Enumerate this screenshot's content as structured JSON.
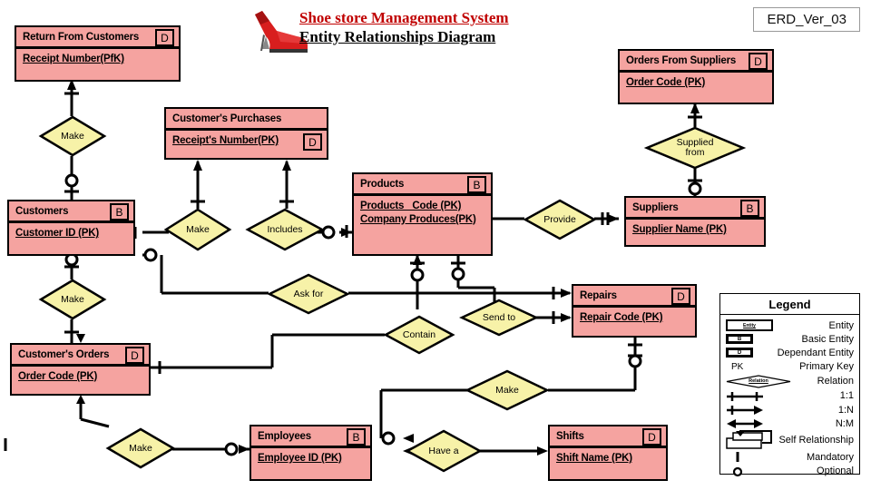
{
  "header": {
    "title_line1": "Shoe store Management System ",
    "title_line2": "Entity   Relationships   Diagram",
    "version": "ERD_Ver_03",
    "logo_icon": "red-high-heel-shoe-icon"
  },
  "colors": {
    "entity_fill": "#F5A3A0",
    "relation_fill": "#F7F2A8",
    "line": "#000000",
    "title_red": "#C00000",
    "version_border": "#999999"
  },
  "entities": [
    {
      "id": "return-from-customers",
      "name": "Return From Customers",
      "badge": "D",
      "badge_row": "head",
      "attributes": [
        "Receipt Number(PfK)"
      ]
    },
    {
      "id": "customers-purchases",
      "name": "Customer's Purchases",
      "badge": "D",
      "badge_row": "row2",
      "attributes": [
        "Receipt's Number(PK)"
      ]
    },
    {
      "id": "orders-from-suppliers",
      "name": "Orders From Suppliers",
      "badge": "D",
      "badge_row": "head",
      "attributes": [
        "Order Code (PK)"
      ]
    },
    {
      "id": "customers",
      "name": "Customers",
      "badge": "B",
      "badge_row": "head",
      "attributes": [
        "Customer ID  (PK)"
      ]
    },
    {
      "id": "products",
      "name": "Products",
      "badge": "B",
      "badge_row": "head",
      "attributes": [
        "Products_ Code (PK)",
        "Company Produces(PK)"
      ]
    },
    {
      "id": "suppliers",
      "name": "Suppliers",
      "badge": "B",
      "badge_row": "head",
      "attributes": [
        "Supplier Name (PK)"
      ]
    },
    {
      "id": "customers-orders",
      "name": "Customer's Orders",
      "badge": "D",
      "badge_row": "head",
      "attributes": [
        "Order Code (PK)"
      ]
    },
    {
      "id": "repairs",
      "name": "Repairs",
      "badge": "D",
      "badge_row": "head",
      "attributes": [
        "Repair Code (PK)"
      ]
    },
    {
      "id": "employees",
      "name": "Employees",
      "badge": "B",
      "badge_row": "head",
      "attributes": [
        "Employee ID  (PK)"
      ]
    },
    {
      "id": "shifts",
      "name": "Shifts",
      "badge": "D",
      "badge_row": "head",
      "attributes": [
        "Shift Name (PK)"
      ]
    }
  ],
  "relationships": [
    {
      "id": "make-return",
      "label": "Make"
    },
    {
      "id": "make-purchases",
      "label": "Make"
    },
    {
      "id": "includes",
      "label": "Includes"
    },
    {
      "id": "supplied-from",
      "label": "Supplied\nfrom"
    },
    {
      "id": "provide",
      "label": "Provide"
    },
    {
      "id": "make-orders",
      "label": "Make"
    },
    {
      "id": "ask-for",
      "label": "Ask for"
    },
    {
      "id": "contain",
      "label": "Contain"
    },
    {
      "id": "send-to",
      "label": "Send to"
    },
    {
      "id": "make-repairs",
      "label": "Make"
    },
    {
      "id": "make-employees",
      "label": "Make"
    },
    {
      "id": "have-a",
      "label": "Have a"
    }
  ],
  "legend": {
    "title": "Legend",
    "rows": [
      {
        "icon": "entity-box-icon",
        "icon_text": "Entity",
        "label": "Entity"
      },
      {
        "icon": "basic-entity-box-icon",
        "icon_text": "B",
        "label": "Basic Entity"
      },
      {
        "icon": "dependant-entity-box-icon",
        "icon_text": "D",
        "label": "Dependant  Entity"
      },
      {
        "icon": "primary-key-icon",
        "icon_text": "PK",
        "label": "Primary Key"
      },
      {
        "icon": "relation-diamond-icon",
        "icon_text": "Relation",
        "label": "Relation"
      },
      {
        "icon": "one-to-one-icon",
        "icon_text": "",
        "label": "1:1"
      },
      {
        "icon": "one-to-many-icon",
        "icon_text": "",
        "label": "1:N"
      },
      {
        "icon": "many-to-many-icon",
        "icon_text": "",
        "label": "N:M"
      },
      {
        "icon": "self-relationship-icon",
        "icon_text": "",
        "label": "Self Relationship"
      },
      {
        "icon": "mandatory-bar-icon",
        "icon_text": "",
        "label": "Mandatory"
      },
      {
        "icon": "optional-circle-icon",
        "icon_text": "",
        "label": "Optional"
      }
    ]
  }
}
